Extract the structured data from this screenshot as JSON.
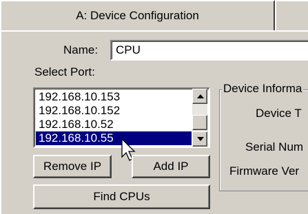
{
  "tabs": [
    {
      "label": "A: Device Configuration"
    },
    {
      "label": ""
    }
  ],
  "name": {
    "label": "Name:",
    "value": "CPU"
  },
  "select_port": {
    "label": "Select Port:"
  },
  "ports": [
    "192.168.10.153",
    "192.168.10.152",
    "192.168.10.52",
    "192.168.10.55"
  ],
  "buttons": {
    "remove_ip": "Remove IP",
    "add_ip": "Add IP",
    "find_cpus": "Find CPUs"
  },
  "device_info": {
    "title": "Device Informa",
    "device_type_label": "Device T",
    "serial_number_label": "Serial Num",
    "firmware_version_label": "Firmware Ver"
  },
  "colors": {
    "face": "#d4d0c8",
    "selection": "#000080"
  }
}
